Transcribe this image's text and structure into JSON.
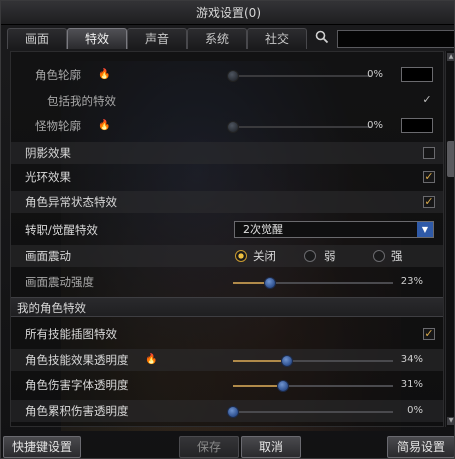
{
  "window": {
    "title": "游戏设置(0)"
  },
  "tabs": [
    {
      "label": "画面",
      "active": false
    },
    {
      "label": "特效",
      "active": true
    },
    {
      "label": "声音",
      "active": false
    },
    {
      "label": "系统",
      "active": false
    },
    {
      "label": "社交",
      "active": false
    }
  ],
  "search": {
    "icon": "search-icon",
    "value": ""
  },
  "settings": {
    "char_outline": {
      "label": "角色轮廓",
      "percent": "0%",
      "level": 0.0,
      "color": "#000000"
    },
    "include_my_effects": {
      "label": "包括我的特效",
      "checked": true
    },
    "monster_outline": {
      "label": "怪物轮廓",
      "percent": "0%",
      "level": 0.0,
      "color": "#000000"
    },
    "shadow_effect": {
      "label": "阴影效果",
      "checked": false
    },
    "aura_effect": {
      "label": "光环效果",
      "checked": true
    },
    "abnormal_status": {
      "label": "角色异常状态特效",
      "checked": true
    },
    "awakening_effect": {
      "label": "转职/觉醒特效",
      "selected": "2次觉醒"
    },
    "screen_shake": {
      "label": "画面震动",
      "options": [
        "关闭",
        "弱",
        "强"
      ],
      "selected": "关闭"
    },
    "shake_intensity": {
      "label": "画面震动强度",
      "percent": "23%",
      "level": 0.23
    }
  },
  "my_char_section": {
    "title": "我的角色特效",
    "all_skill_art": {
      "label": "所有技能插图特效",
      "checked": true
    },
    "skill_transparency": {
      "label": "角色技能效果透明度",
      "percent": "34%",
      "level": 0.34
    },
    "damage_font_transparency": {
      "label": "角色伤害字体透明度",
      "percent": "31%",
      "level": 0.31
    },
    "cumulative_damage_transparency": {
      "label": "角色累积伤害透明度",
      "percent": "0%",
      "level": 0.0
    }
  },
  "footer": {
    "shortcut": "快捷键设置",
    "save": "保存",
    "cancel": "取消",
    "simple": "简易设置"
  },
  "colors": {
    "accent": "#d7a84a",
    "slider_thumb": "#3d68b5",
    "select_arrow": "#2f5aa8"
  }
}
